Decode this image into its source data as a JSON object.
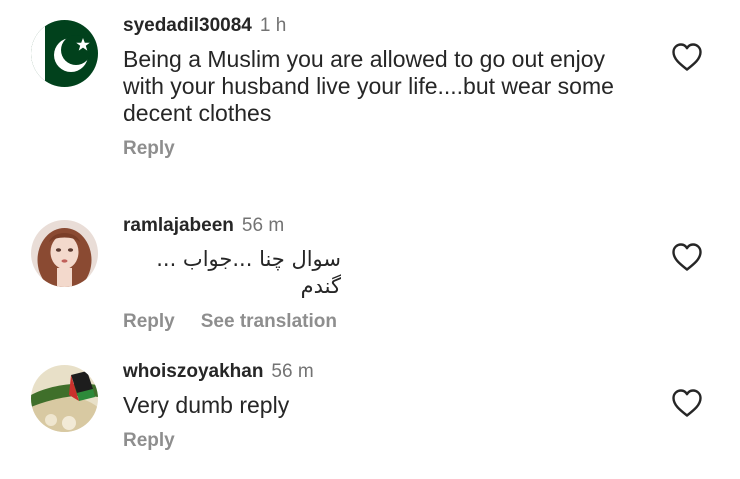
{
  "comments": [
    {
      "username": "syedadil30084",
      "time": "1 h",
      "text": "Being a Muslim you are allowed to go out enjoy with your husband live your life....but wear some decent clothes",
      "reply_label": "Reply"
    },
    {
      "username": "ramlajabeen",
      "time": "56 m",
      "text": "سوال چنا ...جواب ... گندم",
      "reply_label": "Reply",
      "translate_label": "See translation"
    },
    {
      "username": "whoiszoyakhan",
      "time": "56 m",
      "text": "Very dumb reply",
      "reply_label": "Reply"
    }
  ],
  "icons": {
    "like": "heart-outline-icon",
    "avatar_1": "pakistan-flag-avatar",
    "avatar_2": "doll-portrait-avatar",
    "avatar_3": "landscape-photo-avatar"
  },
  "colors": {
    "username": "#262626",
    "secondary_text": "#737373",
    "action_text": "#8e8e8e",
    "flag_green": "#01411c"
  }
}
